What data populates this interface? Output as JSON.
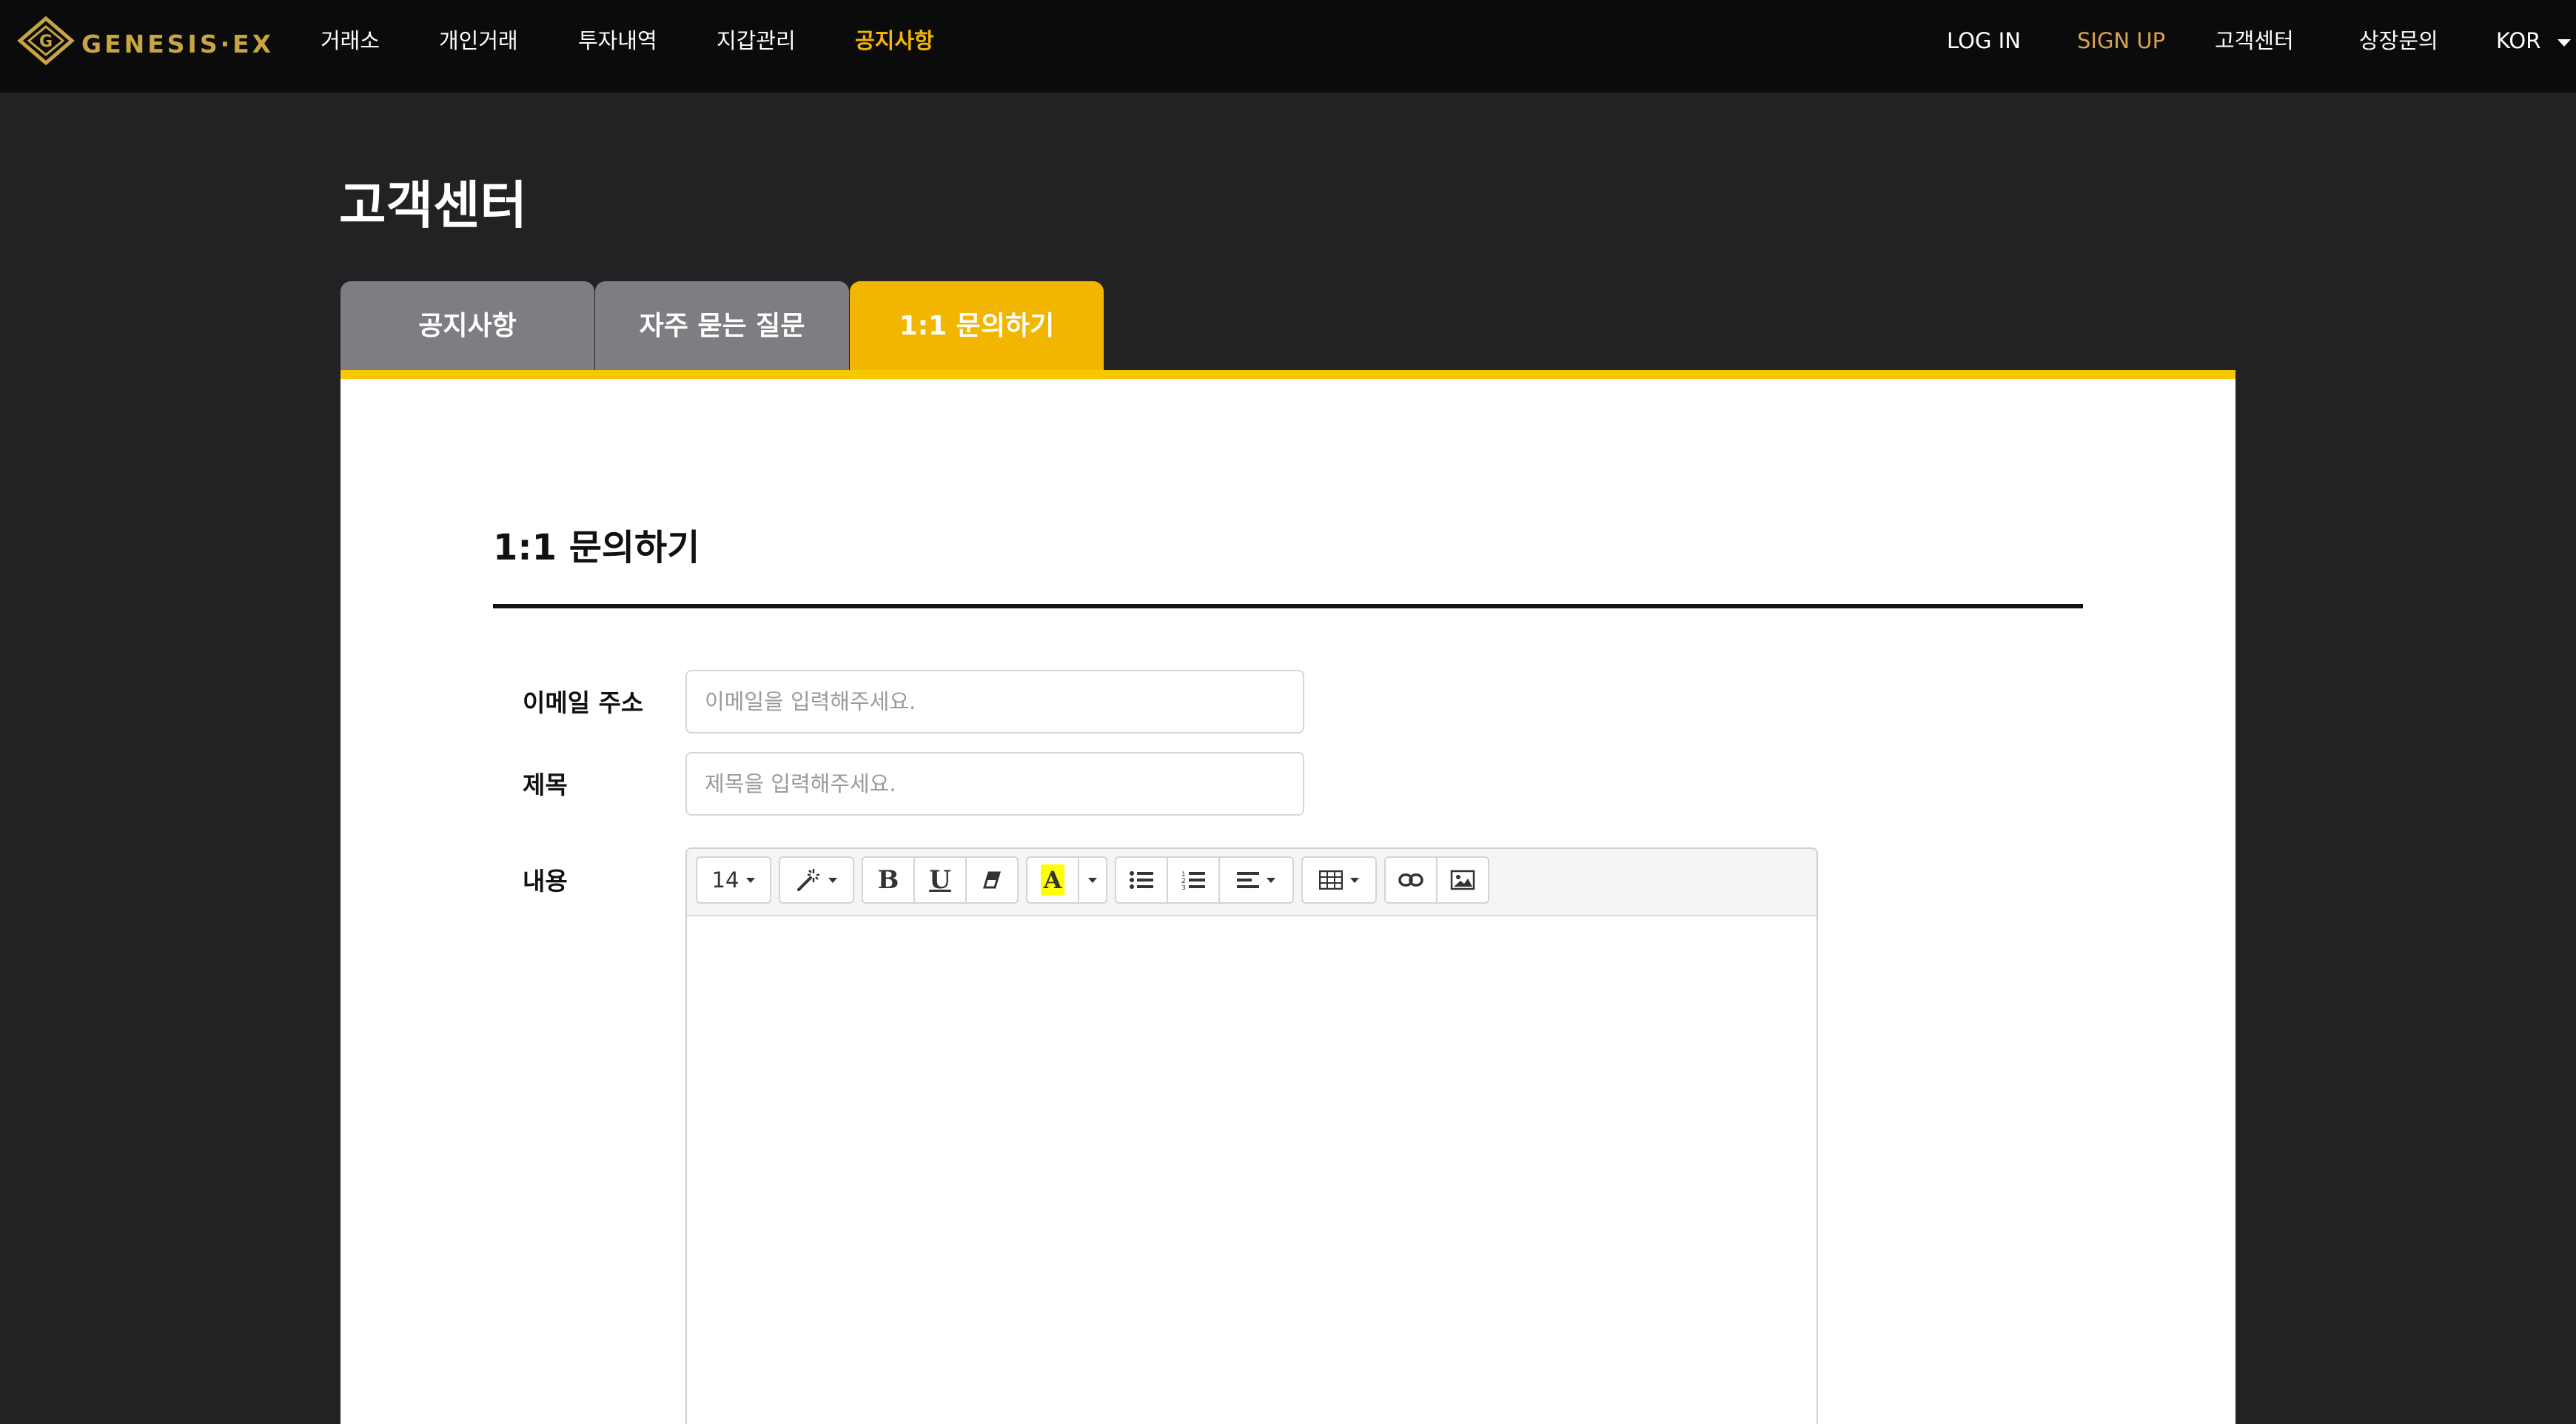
{
  "brand": {
    "logo_text": "GENESIS·EX"
  },
  "nav": {
    "left_items": [
      "거래소",
      "개인거래",
      "투자내역",
      "지갑관리",
      "공지사항"
    ],
    "active_item": "공지사항",
    "right": {
      "login": "LOG IN",
      "signup": "SIGN UP",
      "support": "고객센터",
      "listing": "상장문의",
      "language": "KOR"
    }
  },
  "page": {
    "title": "고객센터"
  },
  "tabs": [
    {
      "label": "공지사항",
      "active": false
    },
    {
      "label": "자주 묻는 질문",
      "active": false
    },
    {
      "label": "1:1 문의하기",
      "active": true
    }
  ],
  "form": {
    "section_title": "1:1 문의하기",
    "email": {
      "label": "이메일 주소",
      "placeholder": "이메일을 입력해주세요.",
      "value": ""
    },
    "subject": {
      "label": "제목",
      "placeholder": "제목을 입력해주세요.",
      "value": ""
    },
    "content": {
      "label": "내용"
    }
  },
  "editor": {
    "font_size": "14",
    "toolbar_icons": [
      "magic-wand-icon",
      "bold-icon",
      "underline-icon",
      "eraser-icon",
      "text-color-icon",
      "unordered-list-icon",
      "ordered-list-icon",
      "align-icon",
      "table-icon",
      "link-icon",
      "picture-icon"
    ],
    "bold_glyph": "B",
    "underline_glyph": "U",
    "color_glyph": "A"
  },
  "colors": {
    "accent": "#f2b600",
    "tab_inactive": "#7e7e82",
    "background": "#222225",
    "topbar": "#0b0b0b",
    "highlight": "#ffff00"
  }
}
